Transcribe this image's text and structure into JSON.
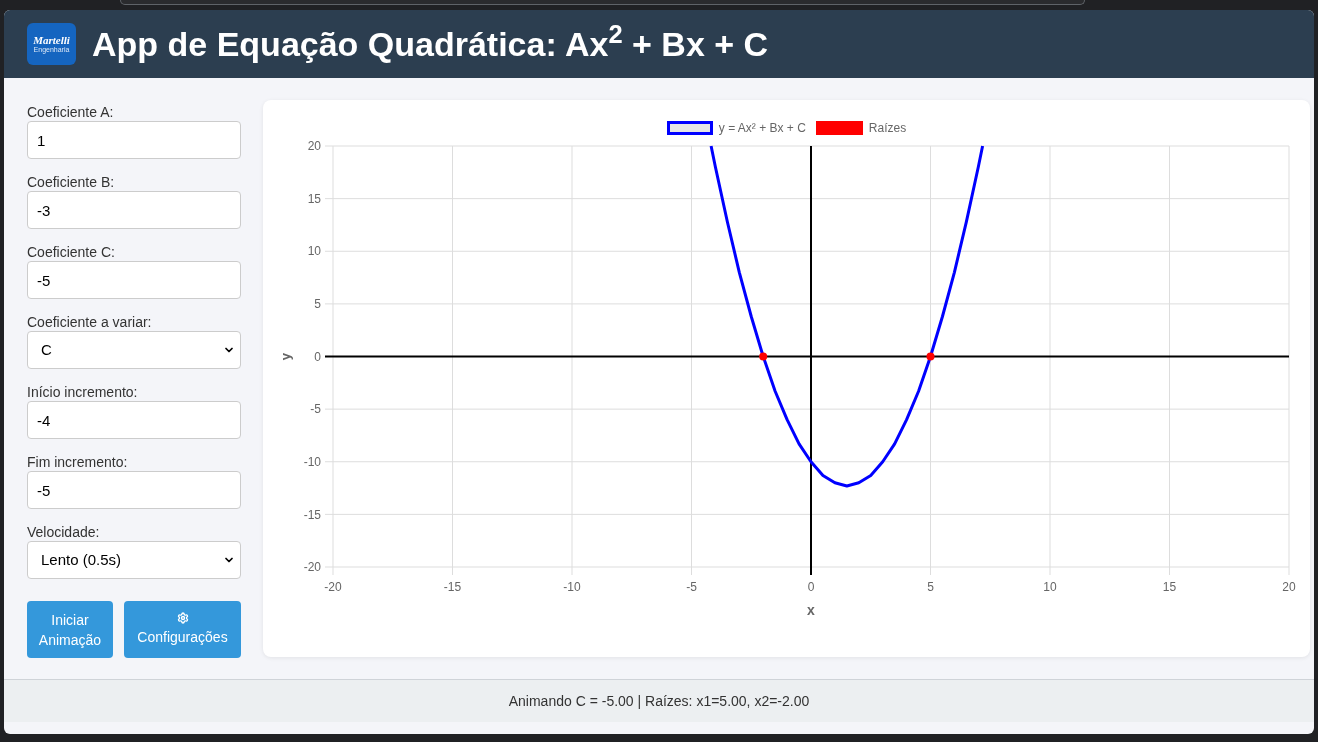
{
  "header": {
    "logo": {
      "wordmark": "Martelli",
      "tagline": "Engenharia"
    },
    "title": "App de Equação Quadrática: Ax$^{2}$ + Bx + C"
  },
  "controls": {
    "fields": [
      {
        "kind": "input",
        "label": "Coeficiente A:",
        "value": "1"
      },
      {
        "kind": "input",
        "label": "Coeficiente B:",
        "value": "-3"
      },
      {
        "kind": "input",
        "label": "Coeficiente C:",
        "value": "-5"
      },
      {
        "kind": "select",
        "label": "Coeficiente a variar:",
        "value": "C"
      },
      {
        "kind": "input",
        "label": "Início incremento:",
        "value": "-4"
      },
      {
        "kind": "input",
        "label": "Fim incremento:",
        "value": "-5"
      },
      {
        "kind": "select",
        "label": "Velocidade:",
        "value": "Lento (0.5s)"
      }
    ],
    "buttons": [
      {
        "kind": "start",
        "label": "Iniciar Animação"
      },
      {
        "kind": "settings",
        "label": "Configurações"
      }
    ]
  },
  "chart": {
    "chart_data": {
      "type": "line",
      "xlabel": "x",
      "ylabel": "y",
      "x": [
        -4.18,
        -4,
        -3.5,
        -3,
        -2.5,
        -2,
        -1.5,
        -1,
        -0.5,
        0,
        0.5,
        1,
        1.5,
        2,
        2.5,
        3,
        3.5,
        4,
        4.5,
        5,
        5.5,
        6,
        6.5,
        7,
        7.18
      ],
      "series": [
        {
          "name": "y = Ax² + Bx + C",
          "color": "#0000ff",
          "type": "line",
          "values": [
            20,
            18,
            12.8,
            8,
            3.8,
            0,
            -3.3,
            -6,
            -8.3,
            -10,
            -11.3,
            -12,
            -12.3,
            -12,
            -11.3,
            -10,
            -8.3,
            -6,
            -3.3,
            0,
            3.8,
            8,
            12.8,
            18,
            20
          ]
        },
        {
          "name": "Raízes",
          "color": "#ff0000",
          "type": "scatter",
          "values": [
            null,
            null,
            null,
            null,
            null,
            0,
            null,
            null,
            null,
            null,
            null,
            null,
            null,
            null,
            null,
            null,
            null,
            null,
            null,
            0,
            null,
            null,
            null,
            null,
            null
          ]
        }
      ],
      "xlim": [
        -20,
        20
      ],
      "ylim": [
        -20,
        20
      ],
      "xticks": [
        -20,
        -15,
        -10,
        -5,
        0,
        5,
        10,
        15,
        20
      ],
      "yticks": [
        -20,
        -15,
        -10,
        -5,
        0,
        5,
        10,
        15,
        20
      ],
      "grid": true,
      "legend": "top"
    }
  },
  "status_bar": {
    "text": "Animando C = -5.00 | Raízes: x1=5.00, x2=-2.00"
  }
}
